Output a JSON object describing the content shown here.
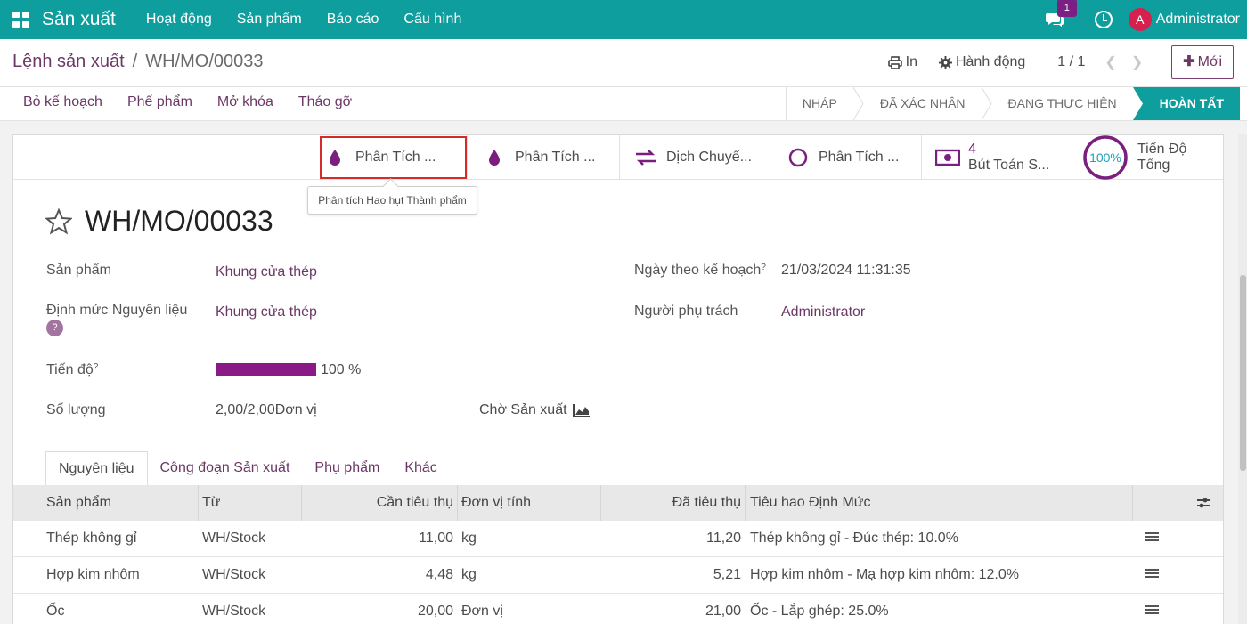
{
  "topbar": {
    "app_name": "Sản xuất",
    "menu": [
      "Hoạt động",
      "Sản phẩm",
      "Báo cáo",
      "Cấu hình"
    ],
    "chat_count": "1",
    "avatar_letter": "A",
    "user": "Administrator"
  },
  "control_panel": {
    "breadcrumb_parent": "Lệnh sản xuất",
    "breadcrumb_separator": "/",
    "breadcrumb_current": "WH/MO/00033",
    "print_label": "In",
    "action_label": "Hành động",
    "pager": "1 / 1",
    "new_label": "Mới"
  },
  "status_buttons": [
    "Bỏ kế hoạch",
    "Phế phẩm",
    "Mở khóa",
    "Tháo gỡ"
  ],
  "stages": [
    "NHÁP",
    "ĐÃ XÁC NHẬN",
    "ĐANG THỰC HIỆN",
    "HOÀN TẤT"
  ],
  "smart_buttons": {
    "b1": "Phân Tích ...",
    "b2": "Phân Tích ...",
    "b3": "Dịch Chuyể...",
    "b4": "Phân Tích ...",
    "b5_count": "4",
    "b5_label": "Bút Toán S...",
    "b6_percent": "100%",
    "b6_label": "Tiến Độ Tổng"
  },
  "tooltip": "Phân tích Hao hụt Thành phẩm",
  "record": {
    "name": "WH/MO/00033",
    "product_label": "Sản phẩm",
    "product_value": "Khung cửa thép",
    "bom_label": "Định mức Nguyên liệu",
    "bom_value": "Khung cửa thép",
    "bom_help": "?",
    "progress_label": "Tiến độ",
    "progress_sup": "?",
    "progress_value": "100 %",
    "progress_fraction": 1.0,
    "qty_label": "Số lượng",
    "qty_value": "2,00/2,00Đơn vị",
    "wait_label": "Chờ Sản xuất",
    "planned_date_label": "Ngày theo kế hoạch",
    "planned_date_sup": "?",
    "planned_date_value": "21/03/2024 11:31:35",
    "responsible_label": "Người phụ trách",
    "responsible_value": "Administrator"
  },
  "tabs": [
    "Nguyên liệu",
    "Công đoạn Sản xuất",
    "Phụ phẩm",
    "Khác"
  ],
  "table": {
    "headers": [
      "Sản phẩm",
      "Từ",
      "Cần tiêu thụ",
      "Đơn vị tính",
      "Đã tiêu thụ",
      "Tiêu hao Định Mức"
    ],
    "rows": [
      [
        "Thép không gỉ",
        "WH/Stock",
        "11,00",
        "kg",
        "11,20",
        "Thép không gỉ - Đúc thép: 10.0%"
      ],
      [
        "Hợp kim nhôm",
        "WH/Stock",
        "4,48",
        "kg",
        "5,21",
        "Hợp kim nhôm - Mạ hợp kim nhôm: 12.0%"
      ],
      [
        "Ốc",
        "WH/Stock",
        "20,00",
        "Đơn vị",
        "21,00",
        "Ốc - Lắp ghép: 25.0%"
      ]
    ]
  },
  "colors": {
    "brand": "#0f9e9e",
    "link": "#6b3866",
    "progress": "#8a1a86",
    "highlight_border": "#d62b2b"
  }
}
